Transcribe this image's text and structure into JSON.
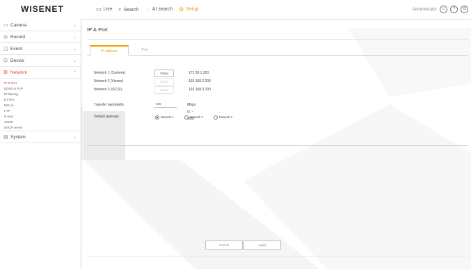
{
  "brand": "WISENET",
  "nav": [
    {
      "label": "Live",
      "icon": "monitor-icon"
    },
    {
      "label": "Search",
      "icon": "search-icon"
    },
    {
      "label": "AI search",
      "icon": "ai-search-icon"
    },
    {
      "label": "Setup",
      "icon": "setup-icon"
    }
  ],
  "top_right": {
    "user": "Administrator"
  },
  "sidebar": {
    "menus": [
      {
        "label": "Camera",
        "icon": "camera-icon"
      },
      {
        "label": "Record",
        "icon": "record-icon"
      },
      {
        "label": "Event",
        "icon": "event-icon"
      },
      {
        "label": "Device",
        "icon": "device-icon"
      },
      {
        "label": "Network",
        "icon": "network-icon"
      }
    ],
    "network_sub": [
      "IP & Port",
      "DDNS & P2P",
      "IP filtering",
      "HTTPS",
      "802.1x",
      "FTP",
      "E-mail",
      "SNMP",
      "DHCP server"
    ],
    "system": {
      "label": "System",
      "icon": "system-icon"
    }
  },
  "page": {
    "title": "IP & Port",
    "tabs": [
      "IP address",
      "Port"
    ]
  },
  "networks": [
    {
      "label": "Network 1 (Camera)",
      "button": "Setup",
      "ip": "172.30.1.200"
    },
    {
      "label": "Network 2 (Viewer)",
      "button": "Setup",
      "ip": "192.168.2.200"
    },
    {
      "label": "Network 3 (iSCSI)",
      "button": "Setup",
      "ip": "192.168.3.200"
    }
  ],
  "bandwidth": {
    "label": "Transfer bandwidth",
    "value": "400",
    "unit": "Mbps (1 ~ 400)"
  },
  "gateway": {
    "label": "Default gateway",
    "options": [
      "Network 1",
      "Network 2",
      "Network 3"
    ],
    "selected": "Network 1"
  },
  "footer": {
    "cancel": "Cancel",
    "apply": "Apply"
  },
  "colors": {
    "accent": "#f0a000",
    "active_menu": "#e0433a"
  }
}
